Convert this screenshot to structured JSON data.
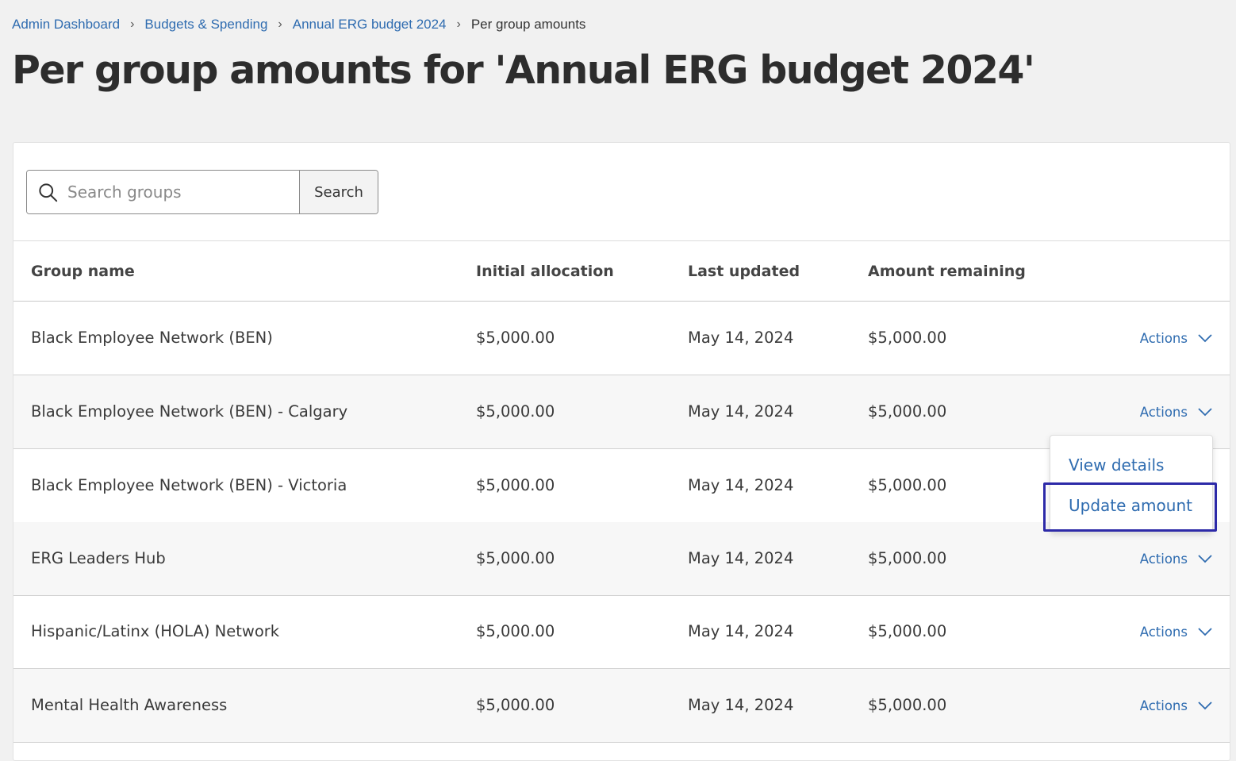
{
  "breadcrumb": {
    "items": [
      "Admin Dashboard",
      "Budgets & Spending",
      "Annual ERG budget 2024"
    ],
    "current": "Per group amounts"
  },
  "page": {
    "title": "Per group amounts for 'Annual ERG budget 2024'"
  },
  "search": {
    "placeholder": "Search groups",
    "value": "",
    "button_label": "Search"
  },
  "table": {
    "headers": [
      "Group name",
      "Initial allocation",
      "Last updated",
      "Amount remaining"
    ],
    "action_label": "Actions",
    "rows": [
      {
        "name": "Black Employee Network (BEN)",
        "initial": "$5,000.00",
        "updated": "May 14, 2024",
        "remaining": "$5,000.00"
      },
      {
        "name": "Black Employee Network (BEN) - Calgary",
        "initial": "$5,000.00",
        "updated": "May 14, 2024",
        "remaining": "$5,000.00"
      },
      {
        "name": "Black Employee Network (BEN) - Victoria",
        "initial": "$5,000.00",
        "updated": "May 14, 2024",
        "remaining": "$5,000.00"
      },
      {
        "name": "ERG Leaders Hub",
        "initial": "$5,000.00",
        "updated": "May 14, 2024",
        "remaining": "$5,000.00"
      },
      {
        "name": "Hispanic/Latinx (HOLA) Network",
        "initial": "$5,000.00",
        "updated": "May 14, 2024",
        "remaining": "$5,000.00"
      },
      {
        "name": "Mental Health Awareness",
        "initial": "$5,000.00",
        "updated": "May 14, 2024",
        "remaining": "$5,000.00"
      }
    ]
  },
  "dropdown": {
    "items": [
      "View details",
      "Update amount"
    ]
  },
  "colors": {
    "link": "#2f6cb0",
    "focus": "#2d2aa8",
    "background": "#f1f1f1"
  },
  "icons": {
    "search": "search-icon",
    "chevron": "chevron-down-icon"
  }
}
